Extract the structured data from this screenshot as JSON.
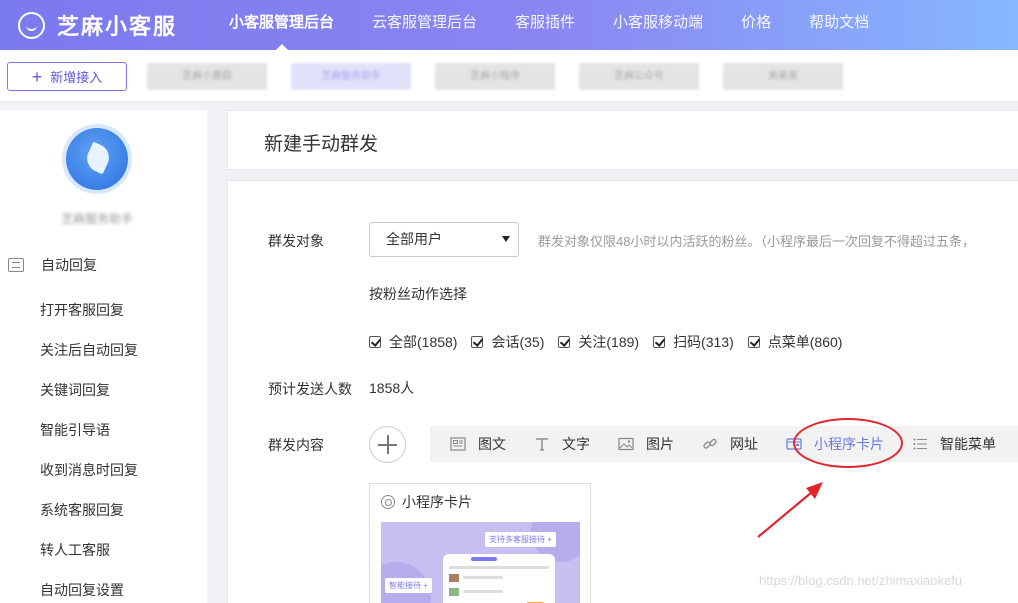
{
  "header": {
    "logo_text": "芝麻小客服",
    "nav": [
      "小客服管理后台",
      "云客服管理后台",
      "客服插件",
      "小客服移动端",
      "价格",
      "帮助文档"
    ],
    "active_nav_index": 0
  },
  "tabbar": {
    "new_button": "新增接入",
    "tabs": [
      "芝麻小蘑菇",
      "芝麻服务助手",
      "芝麻小程序",
      "芝麻公众号",
      "美美美"
    ],
    "selected_tab_index": 1
  },
  "sidebar": {
    "account_name": "芝麻服务助手",
    "section": "自动回复",
    "items": [
      "打开客服回复",
      "关注后自动回复",
      "关键词回复",
      "智能引导语",
      "收到消息时回复",
      "系统客服回复",
      "转人工客服",
      "自动回复设置"
    ]
  },
  "page": {
    "title": "新建手动群发",
    "target_label": "群发对象",
    "target_value": "全部用户",
    "target_hint": "群发对象仅限48小时以内活跃的粉丝。（小程序最后一次回复不得超过五条，",
    "action_label": "按粉丝动作选择",
    "checks": [
      "全部(1858)",
      "会话(35)",
      "关注(189)",
      "扫码(313)",
      "点菜单(860)"
    ],
    "estimate_label": "预计发送人数",
    "estimate_value": "1858人",
    "content_label": "群发内容",
    "tools": [
      {
        "label": "图文",
        "icon": "news-icon"
      },
      {
        "label": "文字",
        "icon": "text-icon"
      },
      {
        "label": "图片",
        "icon": "image-icon"
      },
      {
        "label": "网址",
        "icon": "link-icon"
      },
      {
        "label": "小程序卡片",
        "icon": "miniprogram-card-icon"
      },
      {
        "label": "智能菜单",
        "icon": "menu-list-icon"
      }
    ],
    "active_tool_index": 4,
    "card": {
      "title": "小程序卡片",
      "badge_top": "支持多客服接待 +",
      "badge_left": "智能接待 +"
    }
  },
  "watermark": "https://blog.csdn.net/zhimaxiaokefu",
  "colors": {
    "brand": "#7b79ee",
    "accent_active": "#6b7bd8",
    "annotation_red": "#e3262b"
  }
}
